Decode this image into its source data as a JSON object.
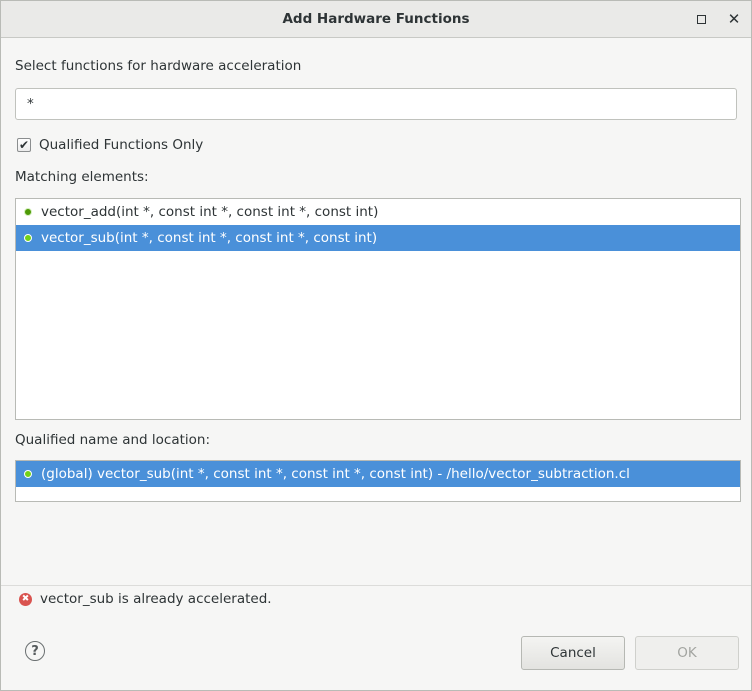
{
  "window": {
    "title": "Add Hardware Functions",
    "maximize_icon": "square-outline",
    "close_icon": "✕"
  },
  "filter": {
    "label": "Select functions for hardware acceleration",
    "value": "*"
  },
  "qualified_only": {
    "label": "Qualified Functions Only",
    "checked": true,
    "check_glyph": "✔"
  },
  "matching": {
    "label": "Matching elements:",
    "items": [
      {
        "text": "vector_add(int *, const int *, const int *, const int)",
        "selected": false
      },
      {
        "text": "vector_sub(int *, const int *, const int *, const int)",
        "selected": true
      }
    ]
  },
  "qualified": {
    "label": "Qualified name and location:",
    "items": [
      {
        "text": "(global) vector_sub(int *, const int *, const int *, const int) - /hello/vector_subtraction.cl",
        "selected": true
      }
    ]
  },
  "status": {
    "error_glyph": "✖",
    "message": "vector_sub is already accelerated."
  },
  "buttons": {
    "help_glyph": "?",
    "cancel_label": "Cancel",
    "ok_label": "OK",
    "ok_enabled": false
  },
  "colors": {
    "selection": "#4a90d9",
    "function_dot": "#4e9a06",
    "error": "#d9534f"
  }
}
